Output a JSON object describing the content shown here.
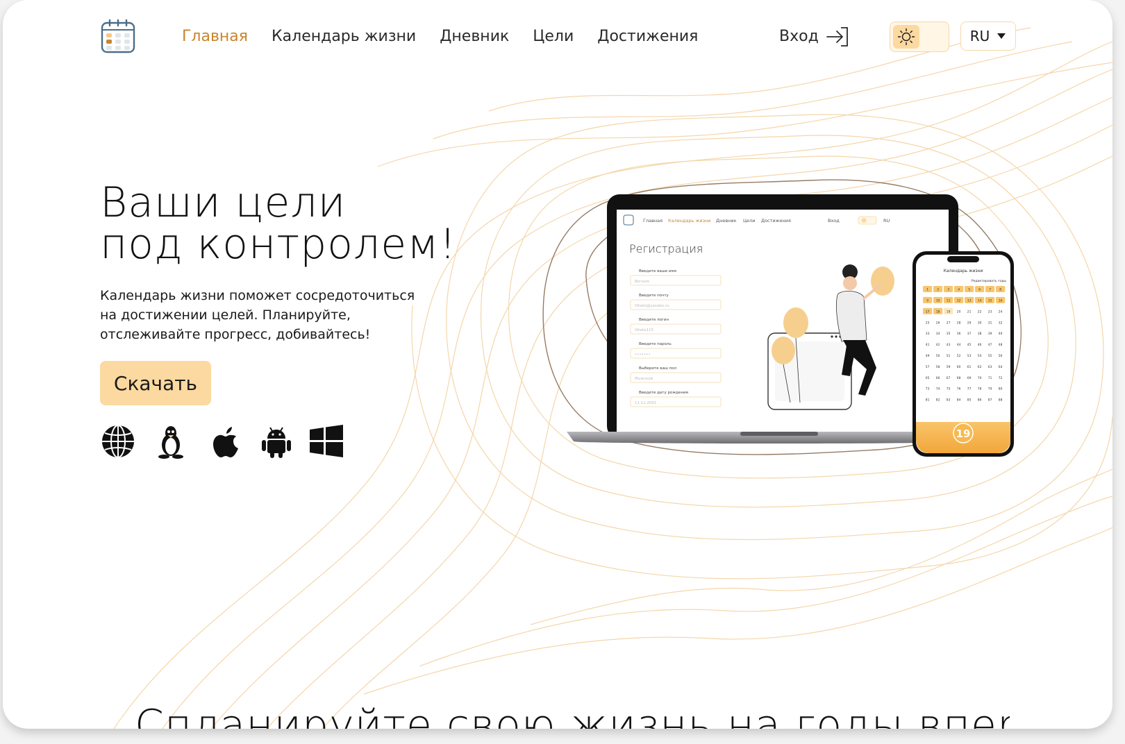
{
  "brand": {
    "logo_icon": "calendar-icon"
  },
  "nav": {
    "items": [
      {
        "label": "Главная",
        "active": true
      },
      {
        "label": "Календарь жизни",
        "active": false
      },
      {
        "label": "Дневник",
        "active": false
      },
      {
        "label": "Цели",
        "active": false
      },
      {
        "label": "Достижения",
        "active": false
      }
    ]
  },
  "header": {
    "login_label": "Вход",
    "login_icon": "login-arrow-icon",
    "theme_icon": "sun-icon",
    "language": "RU",
    "language_icon": "caret-down-icon"
  },
  "hero": {
    "title_line1": "Ваши цели",
    "title_line2": "под контролем!",
    "description": "Календарь жизни поможет сосредоточиться на достижении целей. Планируйте, отслеживайте прогресс, добивайтесь!",
    "download_label": "Скачать",
    "platforms": [
      "globe-icon",
      "linux-icon",
      "apple-icon",
      "android-icon",
      "windows-icon"
    ]
  },
  "laptop_screen": {
    "nav": [
      "Главная",
      "Календарь жизни",
      "Дневник",
      "Цели",
      "Достижения"
    ],
    "login_label": "Вход",
    "language": "RU",
    "title": "Регистрация",
    "fields": [
      {
        "label": "Введите ваше имя",
        "value": "Виталя"
      },
      {
        "label": "Введите почту",
        "value": "Vitalis@yandex.ru"
      },
      {
        "label": "Введите логин",
        "value": "Vitalis115"
      },
      {
        "label": "Введите пароль",
        "value": "•••••••"
      },
      {
        "label": "Выберите ваш пол",
        "value": "Мужской"
      },
      {
        "label": "Введите дату рождения",
        "value": "11.11.2001"
      }
    ]
  },
  "phone_screen": {
    "title": "Календарь жизни",
    "edit_label": "Редактировать годы",
    "badge": "19",
    "grid": [
      [
        "1",
        "2",
        "3",
        "4",
        "5",
        "6",
        "7",
        "8"
      ],
      [
        "9",
        "10",
        "11",
        "12",
        "13",
        "14",
        "15",
        "16"
      ],
      [
        "17",
        "18",
        "19",
        "20",
        "21",
        "22",
        "23",
        "24"
      ],
      [
        "25",
        "26",
        "27",
        "28",
        "29",
        "30",
        "31",
        "32"
      ],
      [
        "33",
        "34",
        "35",
        "36",
        "37",
        "38",
        "39",
        "40"
      ],
      [
        "41",
        "42",
        "43",
        "44",
        "45",
        "46",
        "47",
        "48"
      ],
      [
        "49",
        "50",
        "51",
        "52",
        "53",
        "54",
        "55",
        "56"
      ],
      [
        "57",
        "58",
        "59",
        "60",
        "61",
        "62",
        "63",
        "64"
      ],
      [
        "65",
        "66",
        "67",
        "68",
        "69",
        "70",
        "71",
        "72"
      ],
      [
        "73",
        "74",
        "75",
        "76",
        "77",
        "78",
        "79",
        "80"
      ],
      [
        "81",
        "82",
        "83",
        "84",
        "85",
        "86",
        "87",
        "88"
      ]
    ],
    "highlighted_through": 19
  },
  "bottom": {
    "heading": "Спланируйте свою жизнь на годы вперёд!"
  },
  "colors": {
    "accent": "#c9852e",
    "accent_light": "#fbd9a0",
    "lines": "#f3cf9c",
    "lines_dark": "#8a6d55"
  }
}
